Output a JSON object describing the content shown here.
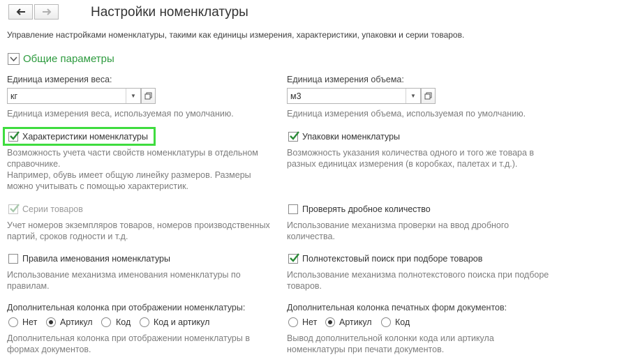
{
  "header": {
    "title": "Настройки номенклатуры",
    "subtitle": "Управление настройками номенклатуры, такими как единицы измерения, характеристики, упаковки и серии товаров."
  },
  "group": {
    "title": "Общие параметры",
    "expanded": true
  },
  "weight_unit": {
    "label": "Единица измерения веса:",
    "value": "кг",
    "hint": "Единица измерения веса, используемая по умолчанию."
  },
  "volume_unit": {
    "label": "Единица измерения объема:",
    "value": "м3",
    "hint": "Единица измерения объема, используемая по умолчанию."
  },
  "characteristics": {
    "label": "Характеристики номенклатуры",
    "checked": true,
    "hint1": "Возможность учета части свойств номенклатуры в отдельном",
    "hint2": "справочнике.",
    "hint3": "Например, обувь имеет общую линейку размеров. Размеры",
    "hint4": "можно учитывать с помощью характеристик."
  },
  "packages": {
    "label": "Упаковки номенклатуры",
    "checked": true,
    "hint1": "Возможность указания количества одного и того же товара в",
    "hint2": "разных единицах измерения (в коробках, палетах и т.д.)."
  },
  "series": {
    "label": "Серии товаров",
    "checked": true,
    "disabled": true,
    "hint1": "Учет номеров экземпляров товаров, номеров производственных",
    "hint2": "партий, сроков годности и т.д."
  },
  "fractional": {
    "label": "Проверять дробное количество",
    "checked": false,
    "hint1": "Использование механизма проверки на ввод дробного",
    "hint2": "количества."
  },
  "naming_rules": {
    "label": "Правила именования номенклатуры",
    "checked": false,
    "hint1": "Использование механизма именования номенклатуры по",
    "hint2": "правилам."
  },
  "fulltext": {
    "label": "Полнотекстовый поиск при подборе товаров",
    "checked": true,
    "hint1": "Использование механизма полнотекстового поиска при подборе",
    "hint2": "товаров."
  },
  "extra_column_display": {
    "label": "Дополнительная колонка при отображении номенклатуры:",
    "options": [
      "Нет",
      "Артикул",
      "Код",
      "Код и артикул"
    ],
    "selected": "Артикул",
    "hint1": "Дополнительная колонка при отображении номенклатуры в",
    "hint2": "формах документов."
  },
  "extra_column_print": {
    "label": "Дополнительная колонка печатных форм документов:",
    "options": [
      "Нет",
      "Артикул",
      "Код"
    ],
    "selected": "Артикул",
    "hint1": "Вывод дополнительной колонки кода или артикула",
    "hint2": "номенклатуры при печати документов."
  },
  "icons": {
    "back": "arrow-left-icon",
    "forward": "arrow-right-icon",
    "dropdown": "triangle-down-icon",
    "open": "open-window-icon",
    "group_toggle": "chevron-down-icon"
  },
  "colors": {
    "accent_green": "#2e9b3f",
    "highlight": "#3fdc3f"
  }
}
